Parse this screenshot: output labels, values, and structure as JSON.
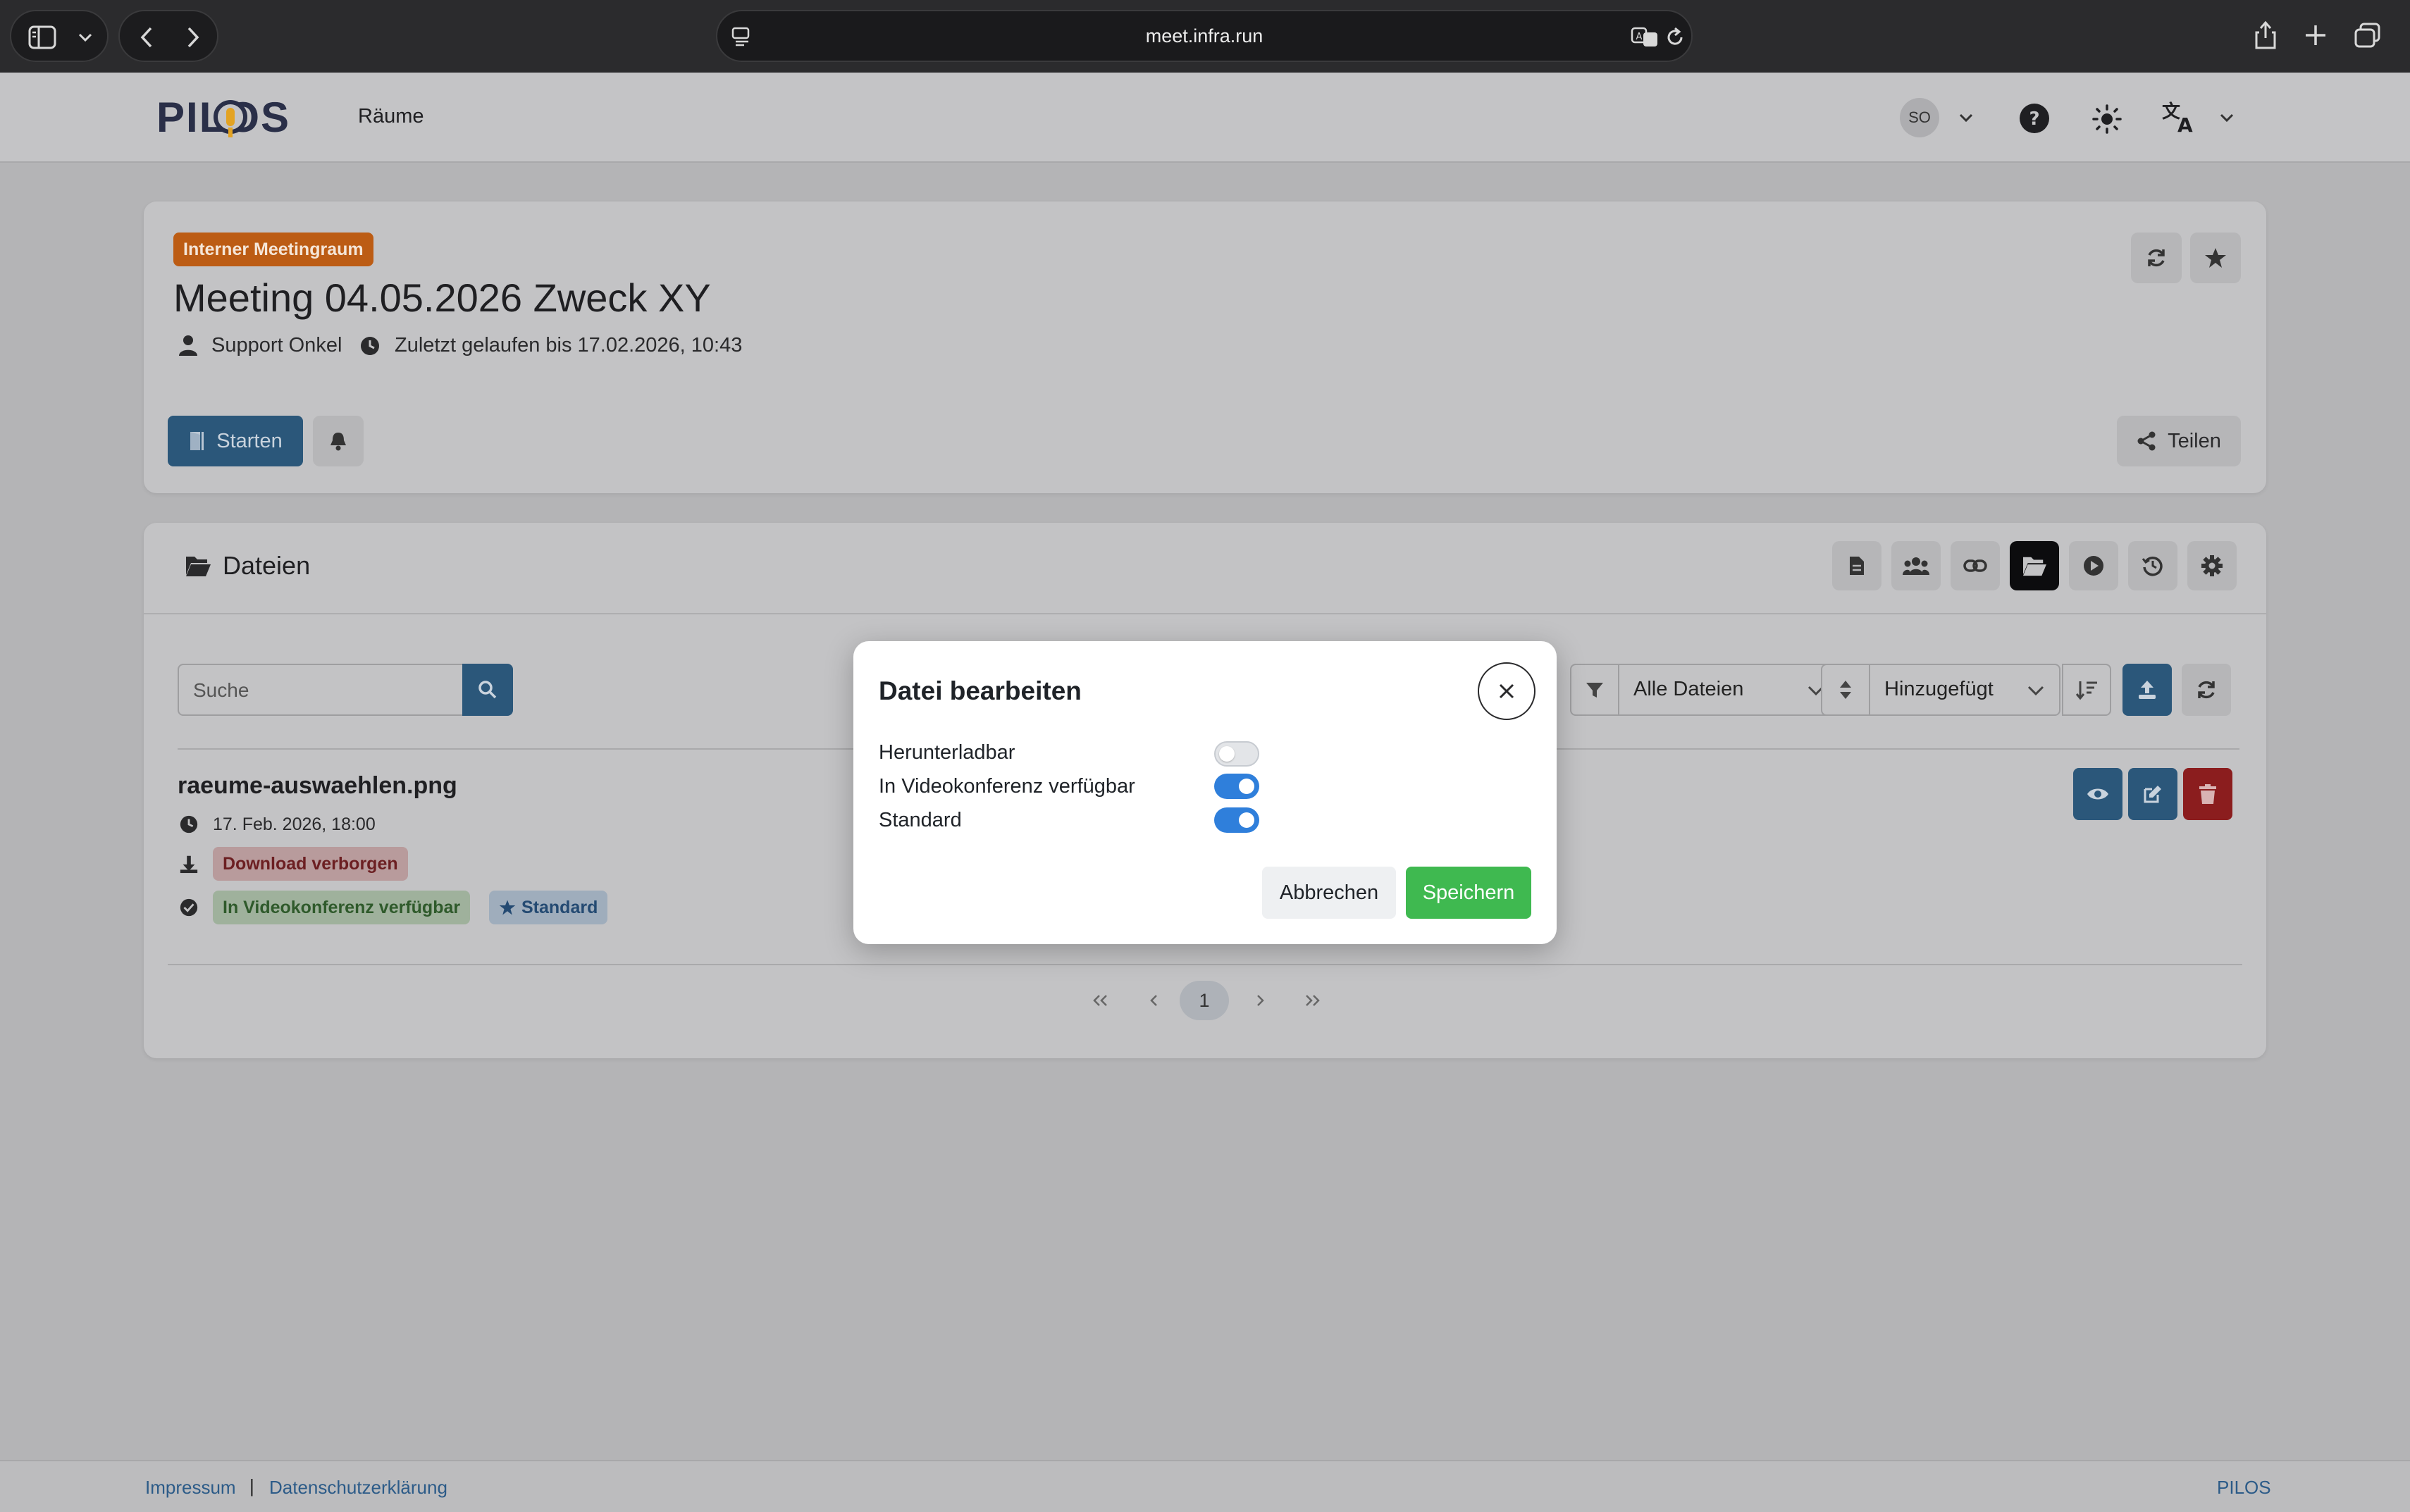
{
  "browser": {
    "url": "meet.infra.run"
  },
  "app": {
    "logo": "PILOS",
    "nav_rooms": "Räume",
    "avatar_initials": "SO"
  },
  "room": {
    "badge": "Interner Meetingraum",
    "title": "Meeting 04.05.2026 Zweck XY",
    "owner": "Support Onkel",
    "last_run": "Zuletzt gelaufen bis 17.02.2026, 10:43",
    "start_label": "Starten",
    "share_label": "Teilen"
  },
  "files": {
    "heading": "Dateien",
    "search_placeholder": "Suche",
    "filter_value": "Alle Dateien",
    "sort_value": "Hinzugefügt",
    "file": {
      "name": "raeume-auswaehlen.png",
      "date": "17. Feb. 2026, 18:00",
      "download_badge": "Download verborgen",
      "video_badge": "In Videokonferenz verfügbar",
      "default_badge": "Standard"
    },
    "pagination": {
      "current_page": "1"
    }
  },
  "modal": {
    "title": "Datei bearbeiten",
    "options": [
      {
        "label": "Herunterladbar",
        "enabled": false
      },
      {
        "label": "In Videokonferenz verfügbar",
        "enabled": true
      },
      {
        "label": "Standard",
        "enabled": true
      }
    ],
    "cancel_label": "Abbrechen",
    "save_label": "Speichern"
  },
  "footer": {
    "imprint": "Impressum",
    "separator": "|",
    "privacy": "Datenschutzerklärung",
    "brand": "PILOS"
  },
  "colors": {
    "primary": "#2f7fdb",
    "save_button": "#3fb950",
    "badge_orange": "#c5651a",
    "danger": "#c92a2a"
  }
}
